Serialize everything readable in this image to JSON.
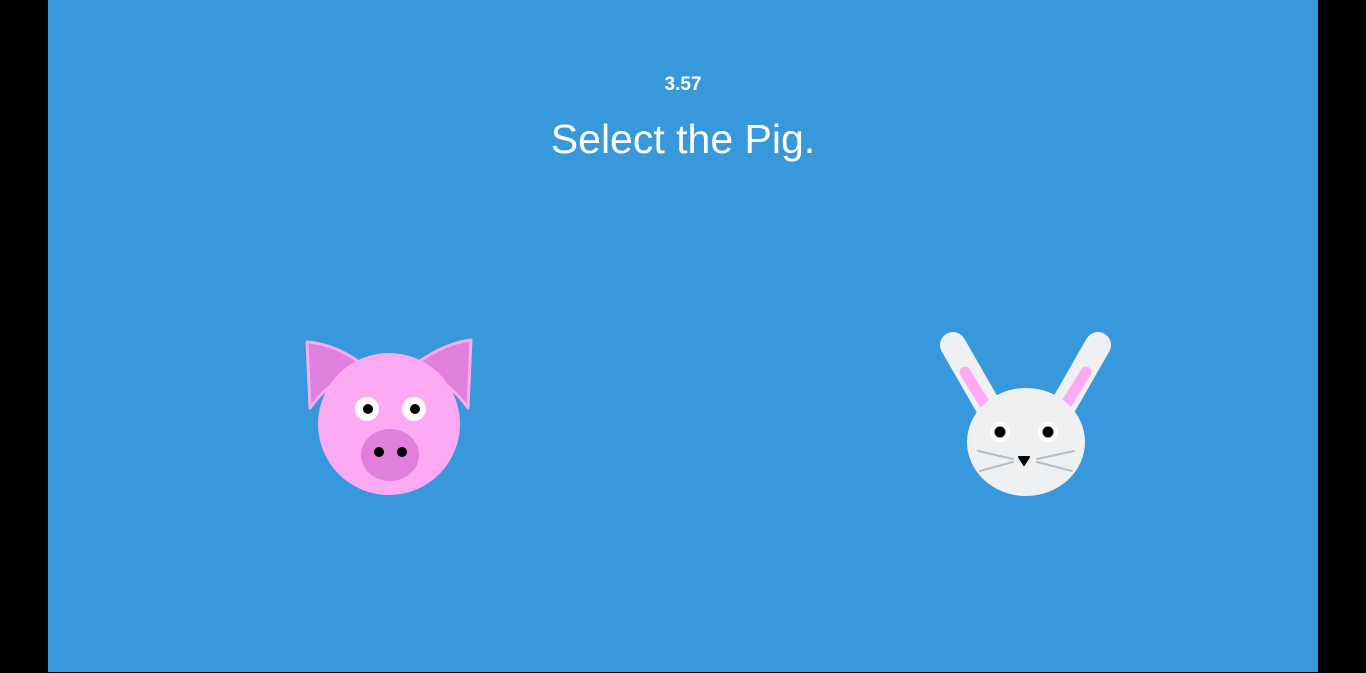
{
  "game": {
    "timer": "3.57",
    "prompt": "Select the Pig."
  },
  "animals": [
    {
      "name": "pig",
      "icon": "pig-icon"
    },
    {
      "name": "bunny",
      "icon": "bunny-icon"
    }
  ],
  "colors": {
    "background": "#3798dc",
    "side_bars": "#000000",
    "text": "#ffffff",
    "pig_face": "#fdaaf5",
    "pig_ears_snout": "#e07fdc",
    "bunny_face": "#eef0f2",
    "bunny_inner_ear": "#fcaaf4"
  }
}
